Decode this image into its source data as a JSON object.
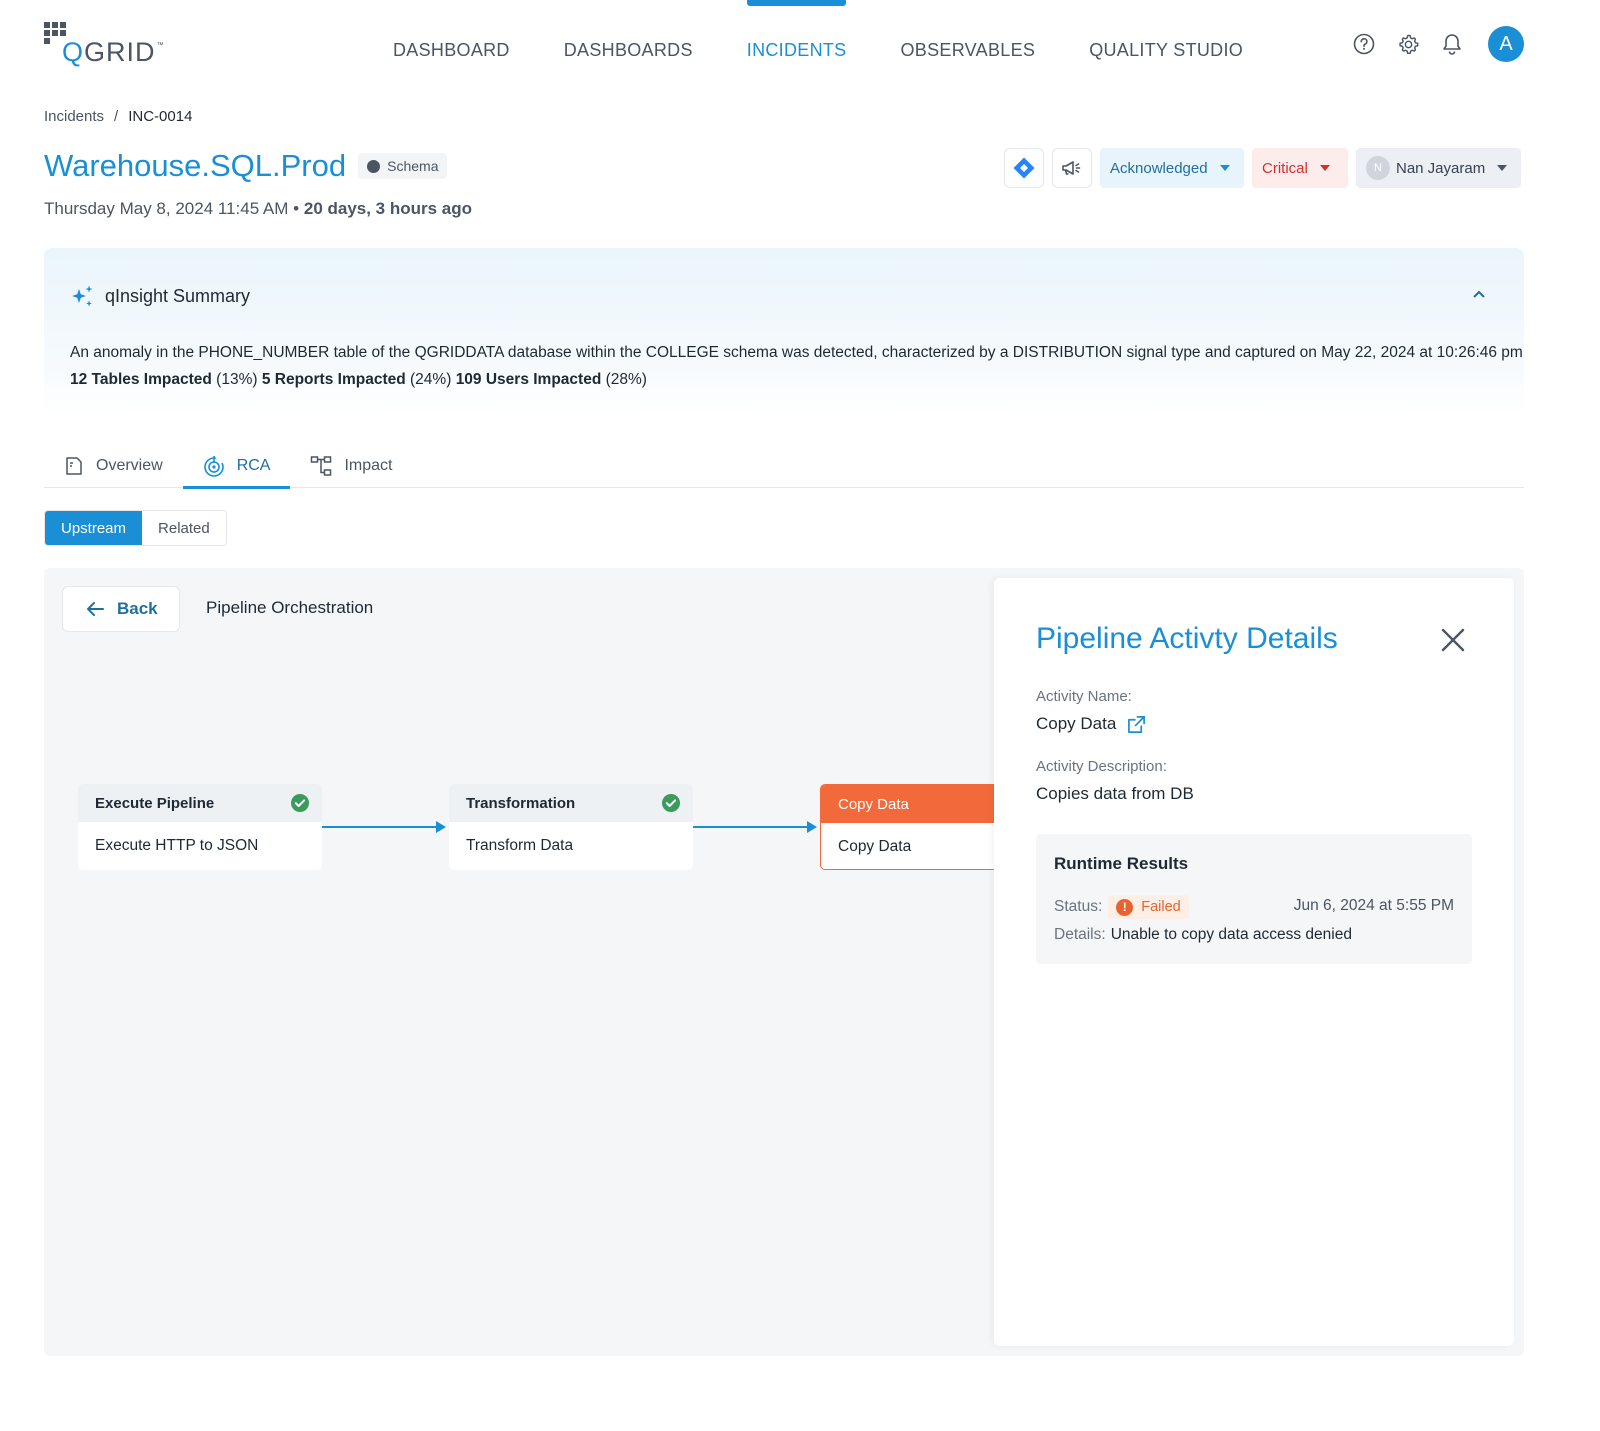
{
  "brand": {
    "logo_text_prefix": "Q",
    "logo_text_rest": "GRID",
    "logo_tm": "™"
  },
  "nav": {
    "items": [
      {
        "label": "DASHBOARD"
      },
      {
        "label": "DASHBOARDS"
      },
      {
        "label": "INCIDENTS",
        "active": true
      },
      {
        "label": "OBSERVABLES"
      },
      {
        "label": "QUALITY STUDIO"
      }
    ],
    "icons": [
      "help-icon",
      "settings-icon",
      "bell-icon"
    ],
    "avatar_initial": "A"
  },
  "breadcrumb": {
    "root": "Incidents",
    "separator": "/",
    "current": "INC-0014"
  },
  "incident": {
    "title": "Warehouse.SQL.Prod",
    "badge": "Schema",
    "date": "Thursday May 8, 2024 11:45 AM",
    "separator": "•",
    "age": "20 days, 3 hours ago"
  },
  "actions": {
    "icons": [
      "jira-icon",
      "announce-icon"
    ],
    "status": "Acknowledged",
    "severity": "Critical",
    "assignee": "Nan Jayaram",
    "assignee_initial": "N"
  },
  "insight": {
    "title": "qInsight Summary",
    "text": "An anomaly in the PHONE_NUMBER table of the QGRIDDATA database within the COLLEGE schema was detected, characterized by a DISTRIBUTION signal type and captured on May 22, 2024 at 10:26:46 pm",
    "stats": [
      {
        "label": "12 Tables Impacted",
        "pct": "(13%)"
      },
      {
        "label": "5 Reports Impacted",
        "pct": "(24%)"
      },
      {
        "label": "109 Users Impacted",
        "pct": "(28%)"
      }
    ]
  },
  "tabs": [
    {
      "label": "Overview",
      "icon": "document-icon"
    },
    {
      "label": "RCA",
      "icon": "target-icon",
      "active": true
    },
    {
      "label": "Impact",
      "icon": "hierarchy-icon"
    }
  ],
  "segments": [
    {
      "label": "Upstream",
      "active": true
    },
    {
      "label": "Related"
    }
  ],
  "canvas": {
    "back_label": "Back",
    "title": "Pipeline Orchestration",
    "nodes": [
      {
        "header": "Execute Pipeline",
        "body": "Execute HTTP to JSON",
        "status": "success"
      },
      {
        "header": "Transformation",
        "body": "Transform Data",
        "status": "success"
      },
      {
        "header": "Copy Data",
        "body": "Copy Data",
        "status": "failed"
      }
    ]
  },
  "panel": {
    "title": "Pipeline Activty Details",
    "activity_name_label": "Activity Name:",
    "activity_name": "Copy Data",
    "activity_desc_label": "Activity Description:",
    "activity_desc": "Copies data from DB",
    "runtime": {
      "title": "Runtime Results",
      "status_label": "Status:",
      "status": "Failed",
      "date": "Jun 6, 2024 at 5:55 PM",
      "details_label": "Details:",
      "details": "Unable to copy data access denied"
    }
  },
  "colors": {
    "accent": "#1a8fd6",
    "failed": "#f26a3b",
    "success": "#3a9b5c",
    "critical": "#d32f2f"
  }
}
